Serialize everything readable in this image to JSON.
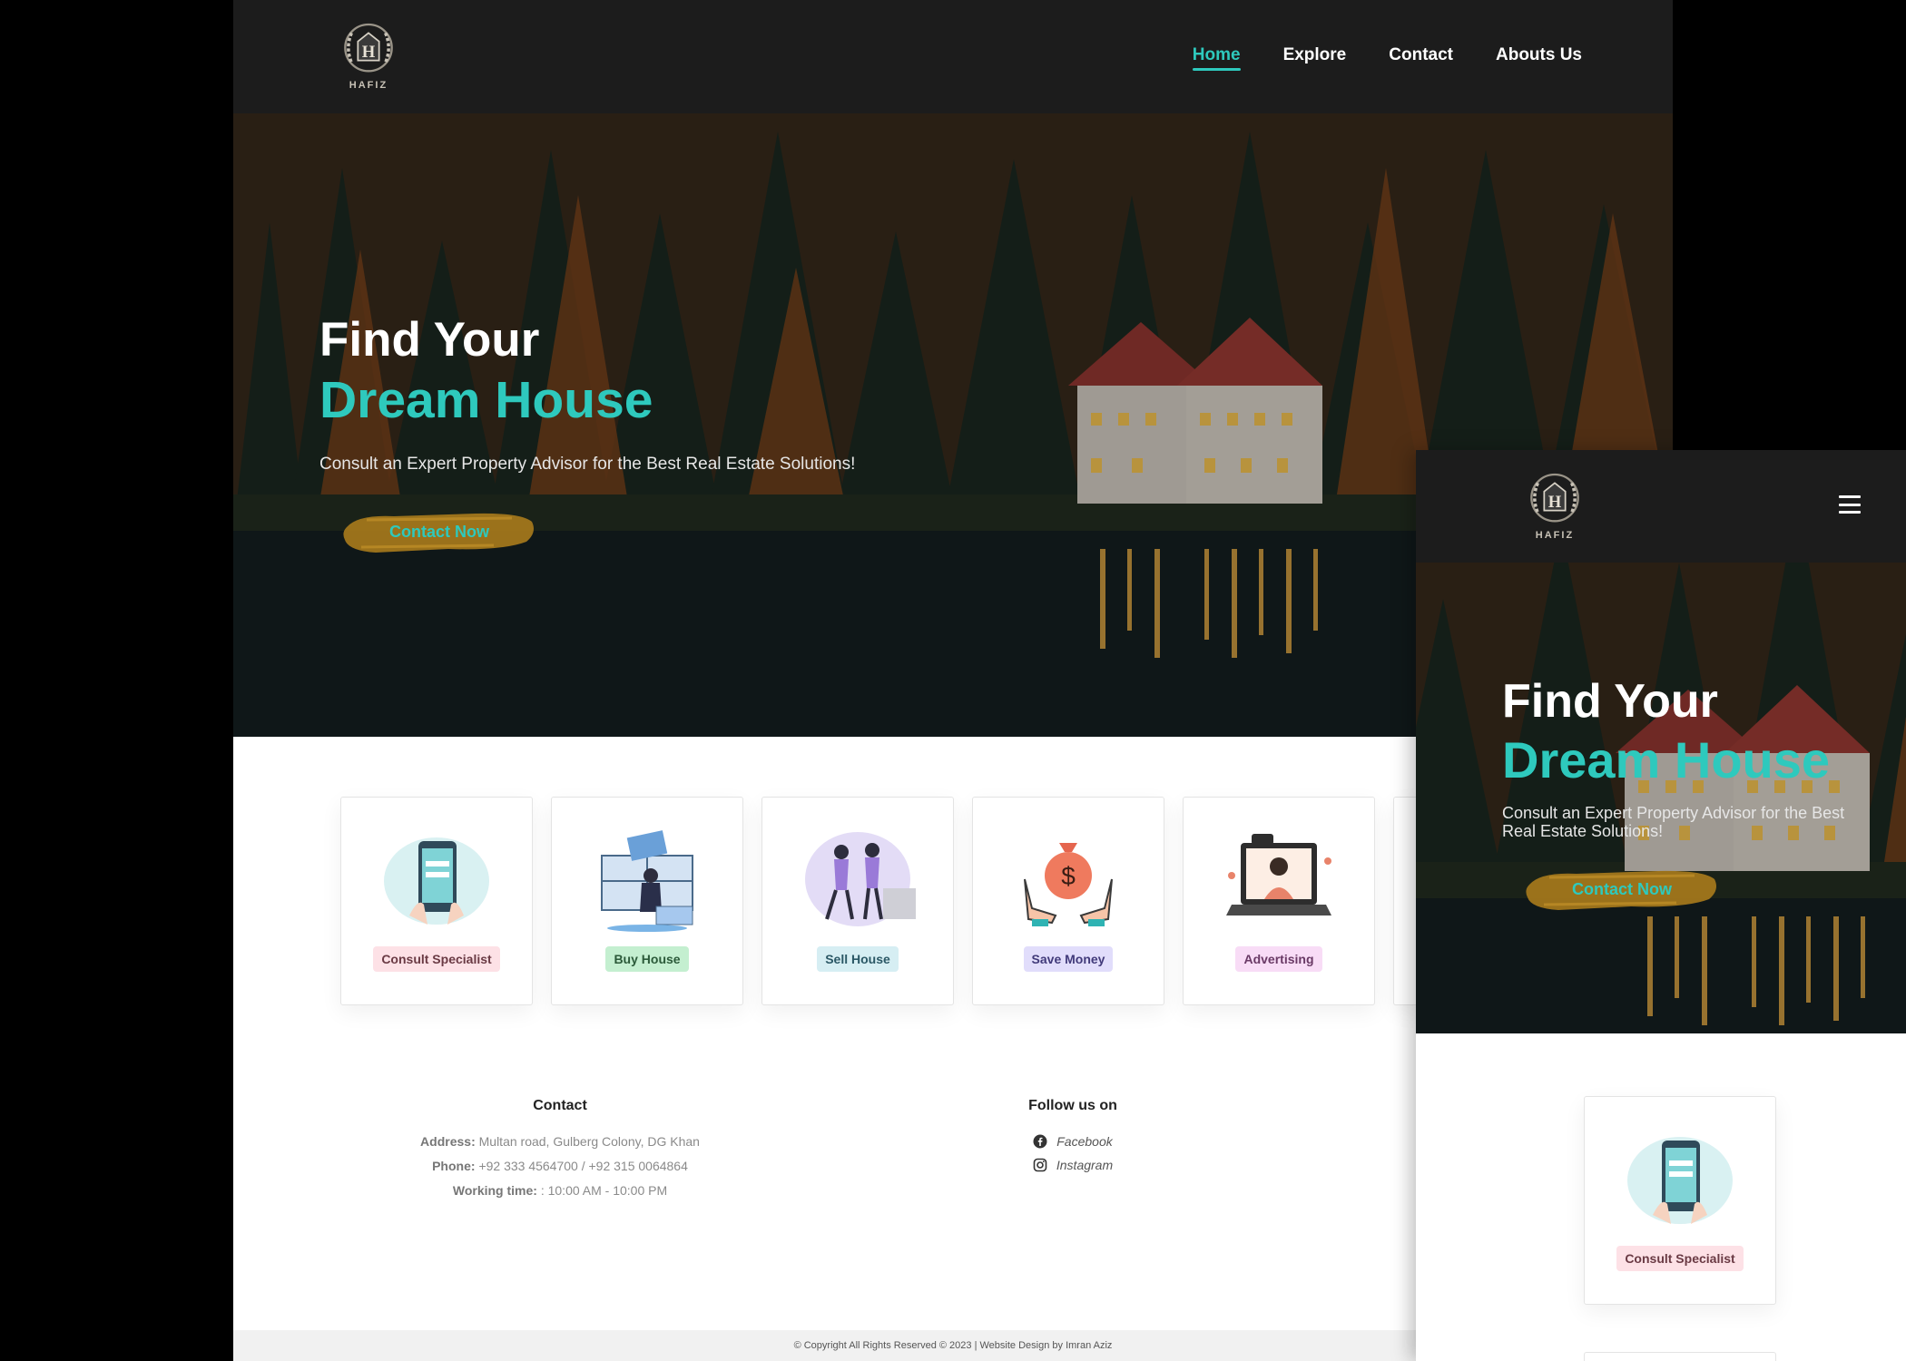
{
  "brand": {
    "logo_text": "HAFIZ"
  },
  "nav": {
    "items": [
      "Home",
      "Explore",
      "Contact",
      "Abouts Us"
    ],
    "active": "Home"
  },
  "hero": {
    "title_line1": "Find Your",
    "title_line2": "Dream House",
    "subtitle": "Consult an Expert Property Advisor for the Best Real Estate Solutions!",
    "cta_label": "Contact Now"
  },
  "services": [
    {
      "label": "Consult Specialist",
      "icon": "phone-consult-illustration",
      "color": "pink"
    },
    {
      "label": "Buy House",
      "icon": "buy-house-illustration",
      "color": "green"
    },
    {
      "label": "Sell House",
      "icon": "sell-house-illustration",
      "color": "blue"
    },
    {
      "label": "Save Money",
      "icon": "money-bag-hands-illustration",
      "color": "lav"
    },
    {
      "label": "Advertising",
      "icon": "laptop-advertising-illustration",
      "color": "mag"
    }
  ],
  "footer": {
    "contact_heading": "Contact",
    "address_label": "Address:",
    "address_value": "Multan road, Gulberg Colony, DG Khan",
    "phone_label": "Phone:",
    "phone_value": "+92 333 4564700 / +92 315 0064864",
    "hours_label": "Working time:",
    "hours_value": ": 10:00 AM - 10:00 PM",
    "follow_heading": "Follow us on",
    "social": [
      {
        "label": "Facebook",
        "icon": "facebook-icon"
      },
      {
        "label": "Instagram",
        "icon": "instagram-icon"
      }
    ],
    "copyright": "© Copyright All Rights Reserved © 2023 | Website Design by Imran Aziz"
  },
  "colors": {
    "accent": "#2ec9bd",
    "header_bg": "#1c1c1c",
    "cta_brush": "#a67a1c"
  }
}
